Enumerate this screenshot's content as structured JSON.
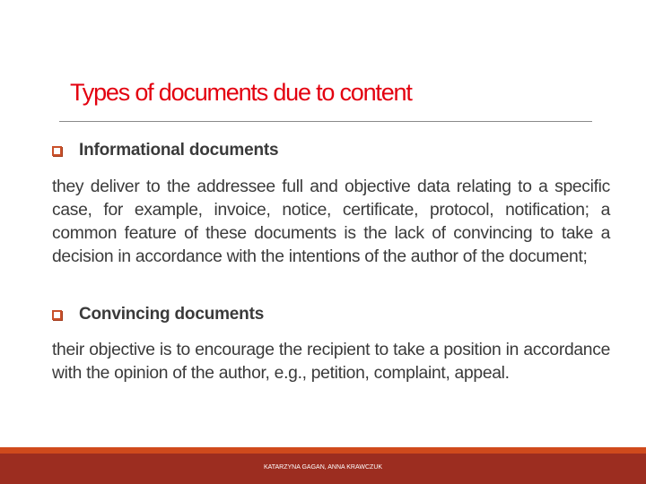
{
  "slide": {
    "title": "Types of documents due to content",
    "sections": [
      {
        "heading": "Informational documents",
        "body": "they deliver to the addressee full and objective data relating to a specific case, for example, invoice, notice, certificate, protocol, notification; a common feature of these documents is the lack of convincing to take a decision in accordance with the intentions of the author of the document;"
      },
      {
        "heading": "Convincing documents",
        "body": "their objective is to encourage the recipient to take a position in accordance with the opinion of the author, e.g., petition, complaint, appeal."
      }
    ],
    "footer": "KATARZYNA GAGAN, ANNA KRAWCZUK"
  },
  "colors": {
    "title": "#e3000f",
    "bullet": "#c9502a",
    "footer_band": "#d04a1c",
    "footer_bg": "#9c2d20",
    "body_text": "#3a3a3a"
  }
}
